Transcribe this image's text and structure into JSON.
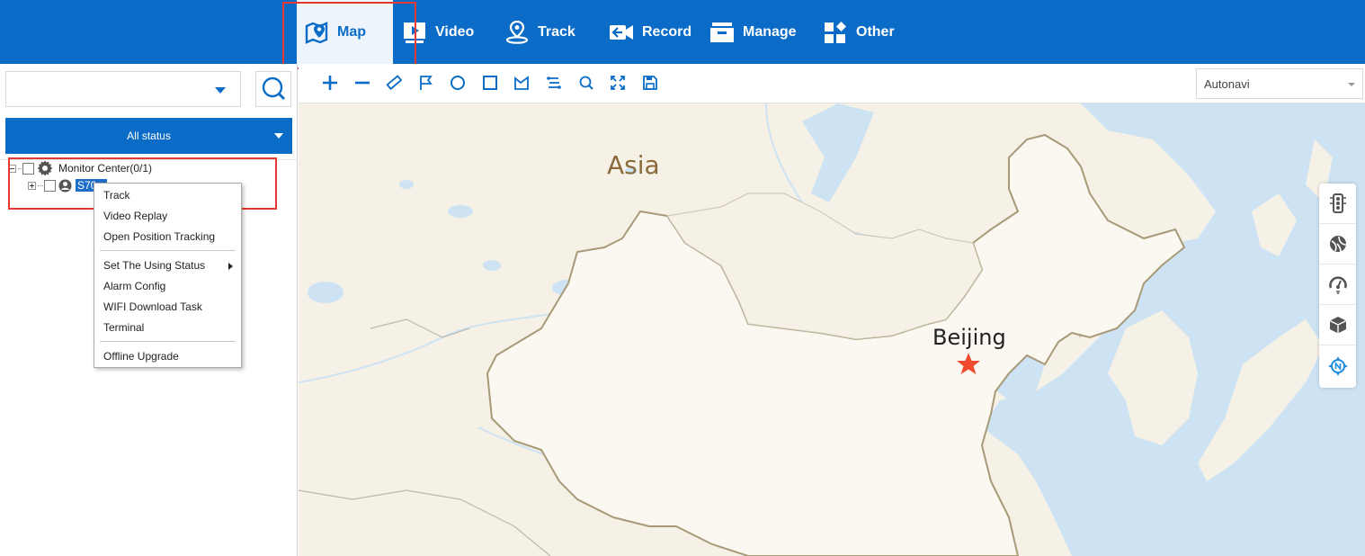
{
  "nav": {
    "items": [
      {
        "label": "Map",
        "icon": "map-pin-icon",
        "active": true
      },
      {
        "label": "Video",
        "icon": "video-play-icon"
      },
      {
        "label": "Track",
        "icon": "track-pin-icon"
      },
      {
        "label": "Record",
        "icon": "record-camera-icon"
      },
      {
        "label": "Manage",
        "icon": "manage-inbox-icon"
      },
      {
        "label": "Other",
        "icon": "other-grid-icon"
      }
    ]
  },
  "left": {
    "device_select_value": "",
    "status_select": "All status",
    "tree": {
      "root_label": "Monitor Center(0/1)",
      "device_label": "S70..."
    }
  },
  "context_menu": {
    "items": [
      "Track",
      "Video Replay",
      "Open Position Tracking",
      "Set The Using Status",
      "Alarm Config",
      "WIFI Download Task",
      "Terminal",
      "Offline Upgrade"
    ]
  },
  "map": {
    "provider": "Autonavi",
    "labels": {
      "continent": "Asia",
      "capital": "Beijing"
    }
  },
  "colors": {
    "brand": "#0a6cc7",
    "highlight_box": "#e53935",
    "map_land": "#f6f1e7",
    "map_water": "#cde3f3"
  }
}
